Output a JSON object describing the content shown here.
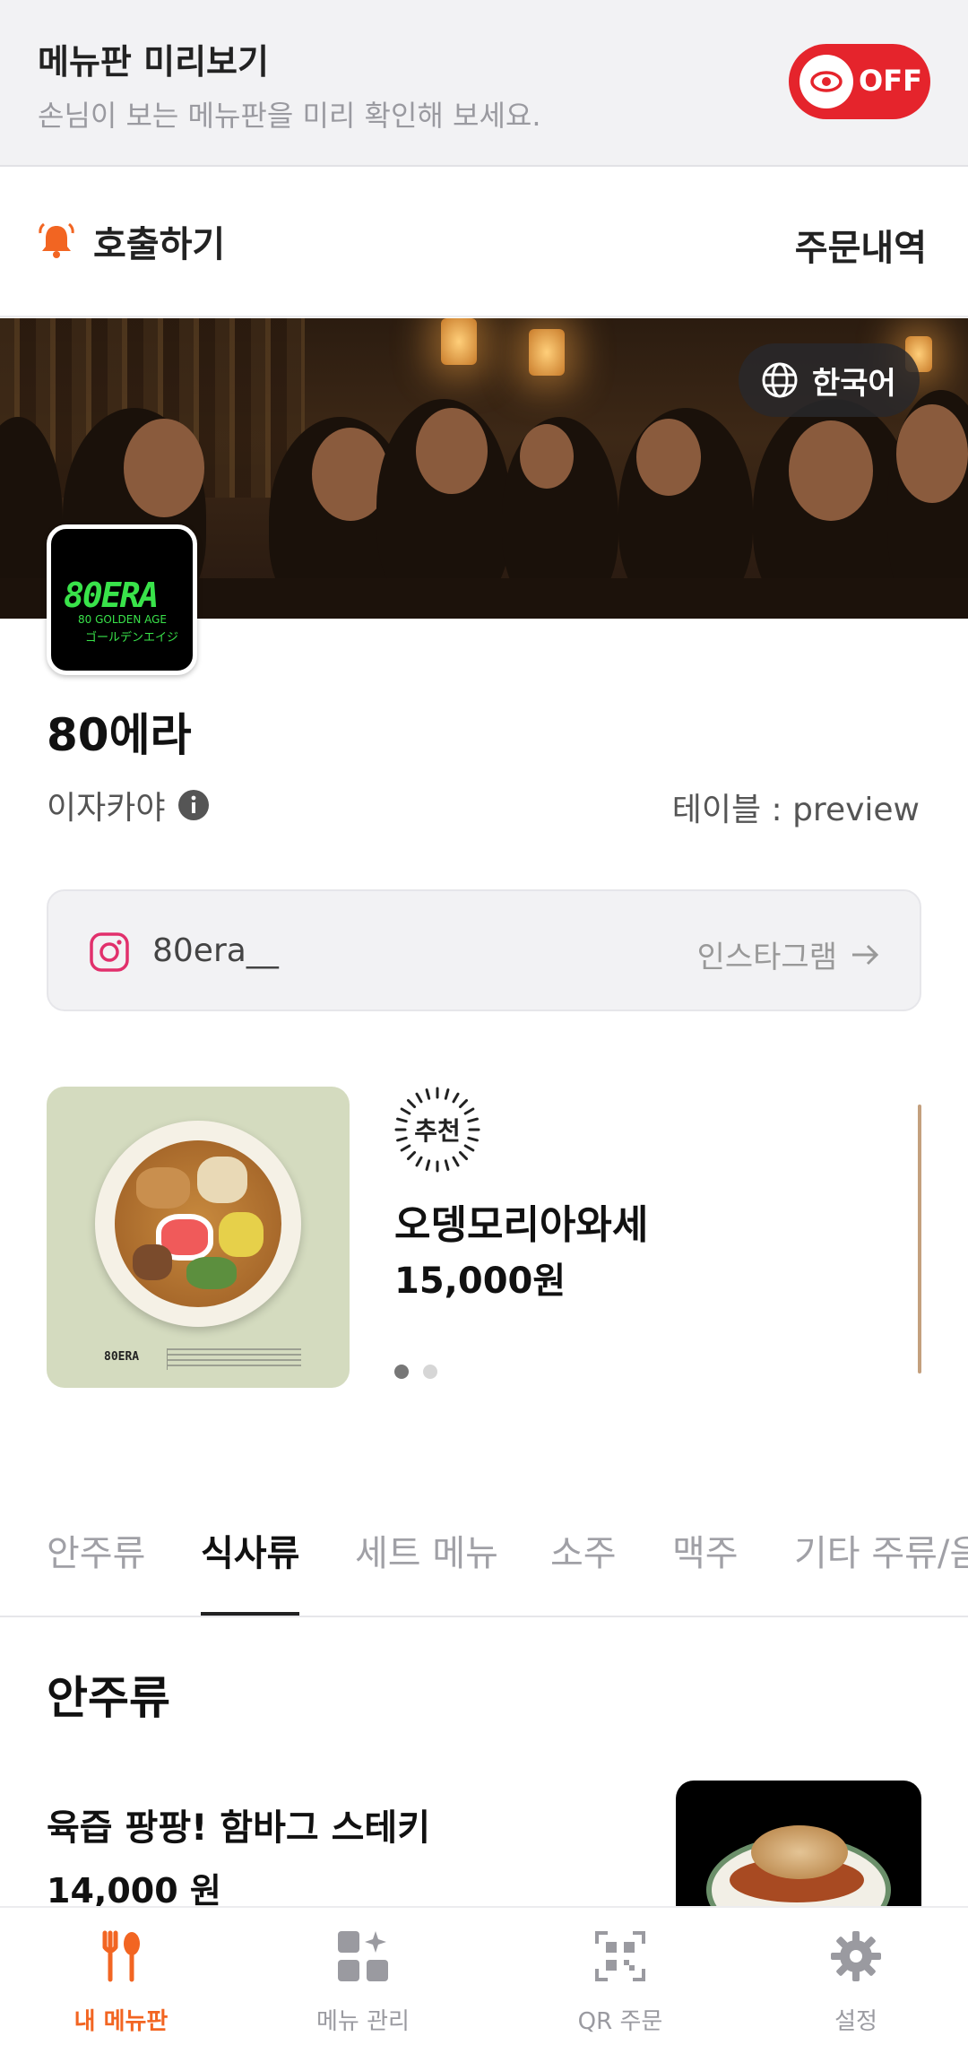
{
  "preview": {
    "title": "메뉴판 미리보기",
    "subtitle": "손님이 보는 메뉴판을 미리 확인해 보세요.",
    "toggle_label": "OFF"
  },
  "header": {
    "call_label": "호출하기",
    "orders_label": "주문내역"
  },
  "banner": {
    "language_label": "한국어"
  },
  "store": {
    "logo_main": "80ERA",
    "logo_sub": "80 GOLDEN AGE",
    "logo_sub2": "ゴールデンエイジ",
    "name": "80에라",
    "category": "이자카야",
    "table_info": "테이블 : preview",
    "instagram_id": "80era__",
    "instagram_link": "인스타그램"
  },
  "recommend": {
    "badge": "추천",
    "name": "오뎅모리아와세",
    "price": "15,000원",
    "image_brand": "80ERA",
    "active_slide": 1,
    "slide_count": 2
  },
  "tabs": [
    {
      "label": "안주류",
      "active": false
    },
    {
      "label": "식사류",
      "active": true
    },
    {
      "label": "세트 메뉴",
      "active": false
    },
    {
      "label": "소주",
      "active": false
    },
    {
      "label": "맥주",
      "active": false
    },
    {
      "label": "기타 주류/음",
      "active": false
    }
  ],
  "section": {
    "title": "안주류",
    "items": [
      {
        "name": "육즙 팡팡! 함바그 스테키",
        "price": "14,000 원"
      }
    ]
  },
  "bottom_nav": [
    {
      "label": "내 메뉴판",
      "icon": "fork-spoon-icon",
      "active": true
    },
    {
      "label": "메뉴 관리",
      "icon": "grid-sparkle-icon",
      "active": false
    },
    {
      "label": "QR 주문",
      "icon": "qr-code-icon",
      "active": false
    },
    {
      "label": "설정",
      "icon": "gear-icon",
      "active": false
    }
  ],
  "colors": {
    "accent": "#f26522",
    "toggle": "#e5242c",
    "logo_green": "#39e34a",
    "instagram": "#e1306c"
  }
}
